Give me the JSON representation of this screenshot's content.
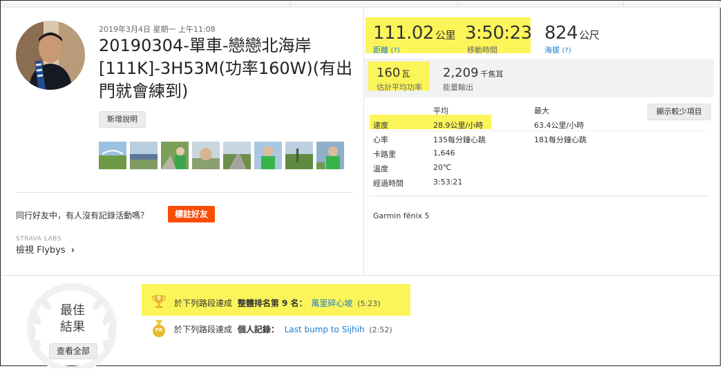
{
  "activity": {
    "date": "2019年3月4日 星期一 上午11:08",
    "title": "20190304-單車-戀戀北海岸[111K]-3H53M(功率160W)(有出門就會練到)",
    "add_description_label": "新增說明"
  },
  "photos": [
    {
      "kind": "field"
    },
    {
      "kind": "river"
    },
    {
      "kind": "rider-path"
    },
    {
      "kind": "rider-face"
    },
    {
      "kind": "road"
    },
    {
      "kind": "rider-green"
    },
    {
      "kind": "river-trees"
    },
    {
      "kind": "road-trees"
    },
    {
      "kind": "rider-green"
    }
  ],
  "friends": {
    "prompt": "同行好友中，有人沒有記錄活動嗎？",
    "tag_button": "標註好友"
  },
  "flybys": {
    "labs_label": "STRAVA LABS",
    "link_text": "檢視 Flybys",
    "chevron": "›"
  },
  "primary_stats": {
    "distance": {
      "value": "111.02",
      "unit": "公里",
      "label": "距離",
      "help": "(?)"
    },
    "moving_time": {
      "value": "3:50:23",
      "label": "移動時間"
    },
    "elevation": {
      "value": "824",
      "unit": "公尺",
      "label": "海拔",
      "help": "(?)"
    }
  },
  "secondary_stats": {
    "power": {
      "value": "160",
      "unit": "瓦",
      "label": "估計平均功率"
    },
    "energy": {
      "value": "2,209",
      "unit": "千焦耳",
      "label": "能量輸出"
    }
  },
  "detail_table": {
    "col_avg": "平均",
    "col_max": "最大",
    "show_less_button": "顯示較少項目",
    "rows": [
      {
        "label": "速度",
        "avg": "28.9公里/小時",
        "max": "63.4公里/小時"
      },
      {
        "label": "心率",
        "avg": "135每分鐘心跳",
        "max": "181每分鐘心跳"
      },
      {
        "label": "卡路里",
        "avg": "1,646",
        "max": ""
      },
      {
        "label": "溫度",
        "avg": "20℃",
        "max": ""
      },
      {
        "label": "經過時間",
        "avg": "3:53:21",
        "max": ""
      }
    ]
  },
  "device": "Garmin fēnix 5",
  "best_results": {
    "heading_line1": "最佳",
    "heading_line2": "結果",
    "view_all_button": "查看全部",
    "achievements": [
      {
        "icon": "trophy-icon",
        "medal_text": "9",
        "prefix": "於下列路段達成",
        "rank_text": "整體排名第 9 名：",
        "segment": "萬里碎心坡",
        "time": "(5:23)"
      },
      {
        "icon": "pr-medal-icon",
        "medal_text": "PR",
        "prefix": "於下列路段達成",
        "rank_text": "個人記錄：",
        "segment": "Last bump to Sijhih",
        "time": "(2:52)"
      }
    ]
  },
  "colors": {
    "highlight": "#fbf55a",
    "strava_orange": "#fc4c02",
    "link_blue": "#1b7ed1",
    "gold": "#e8b92c"
  }
}
